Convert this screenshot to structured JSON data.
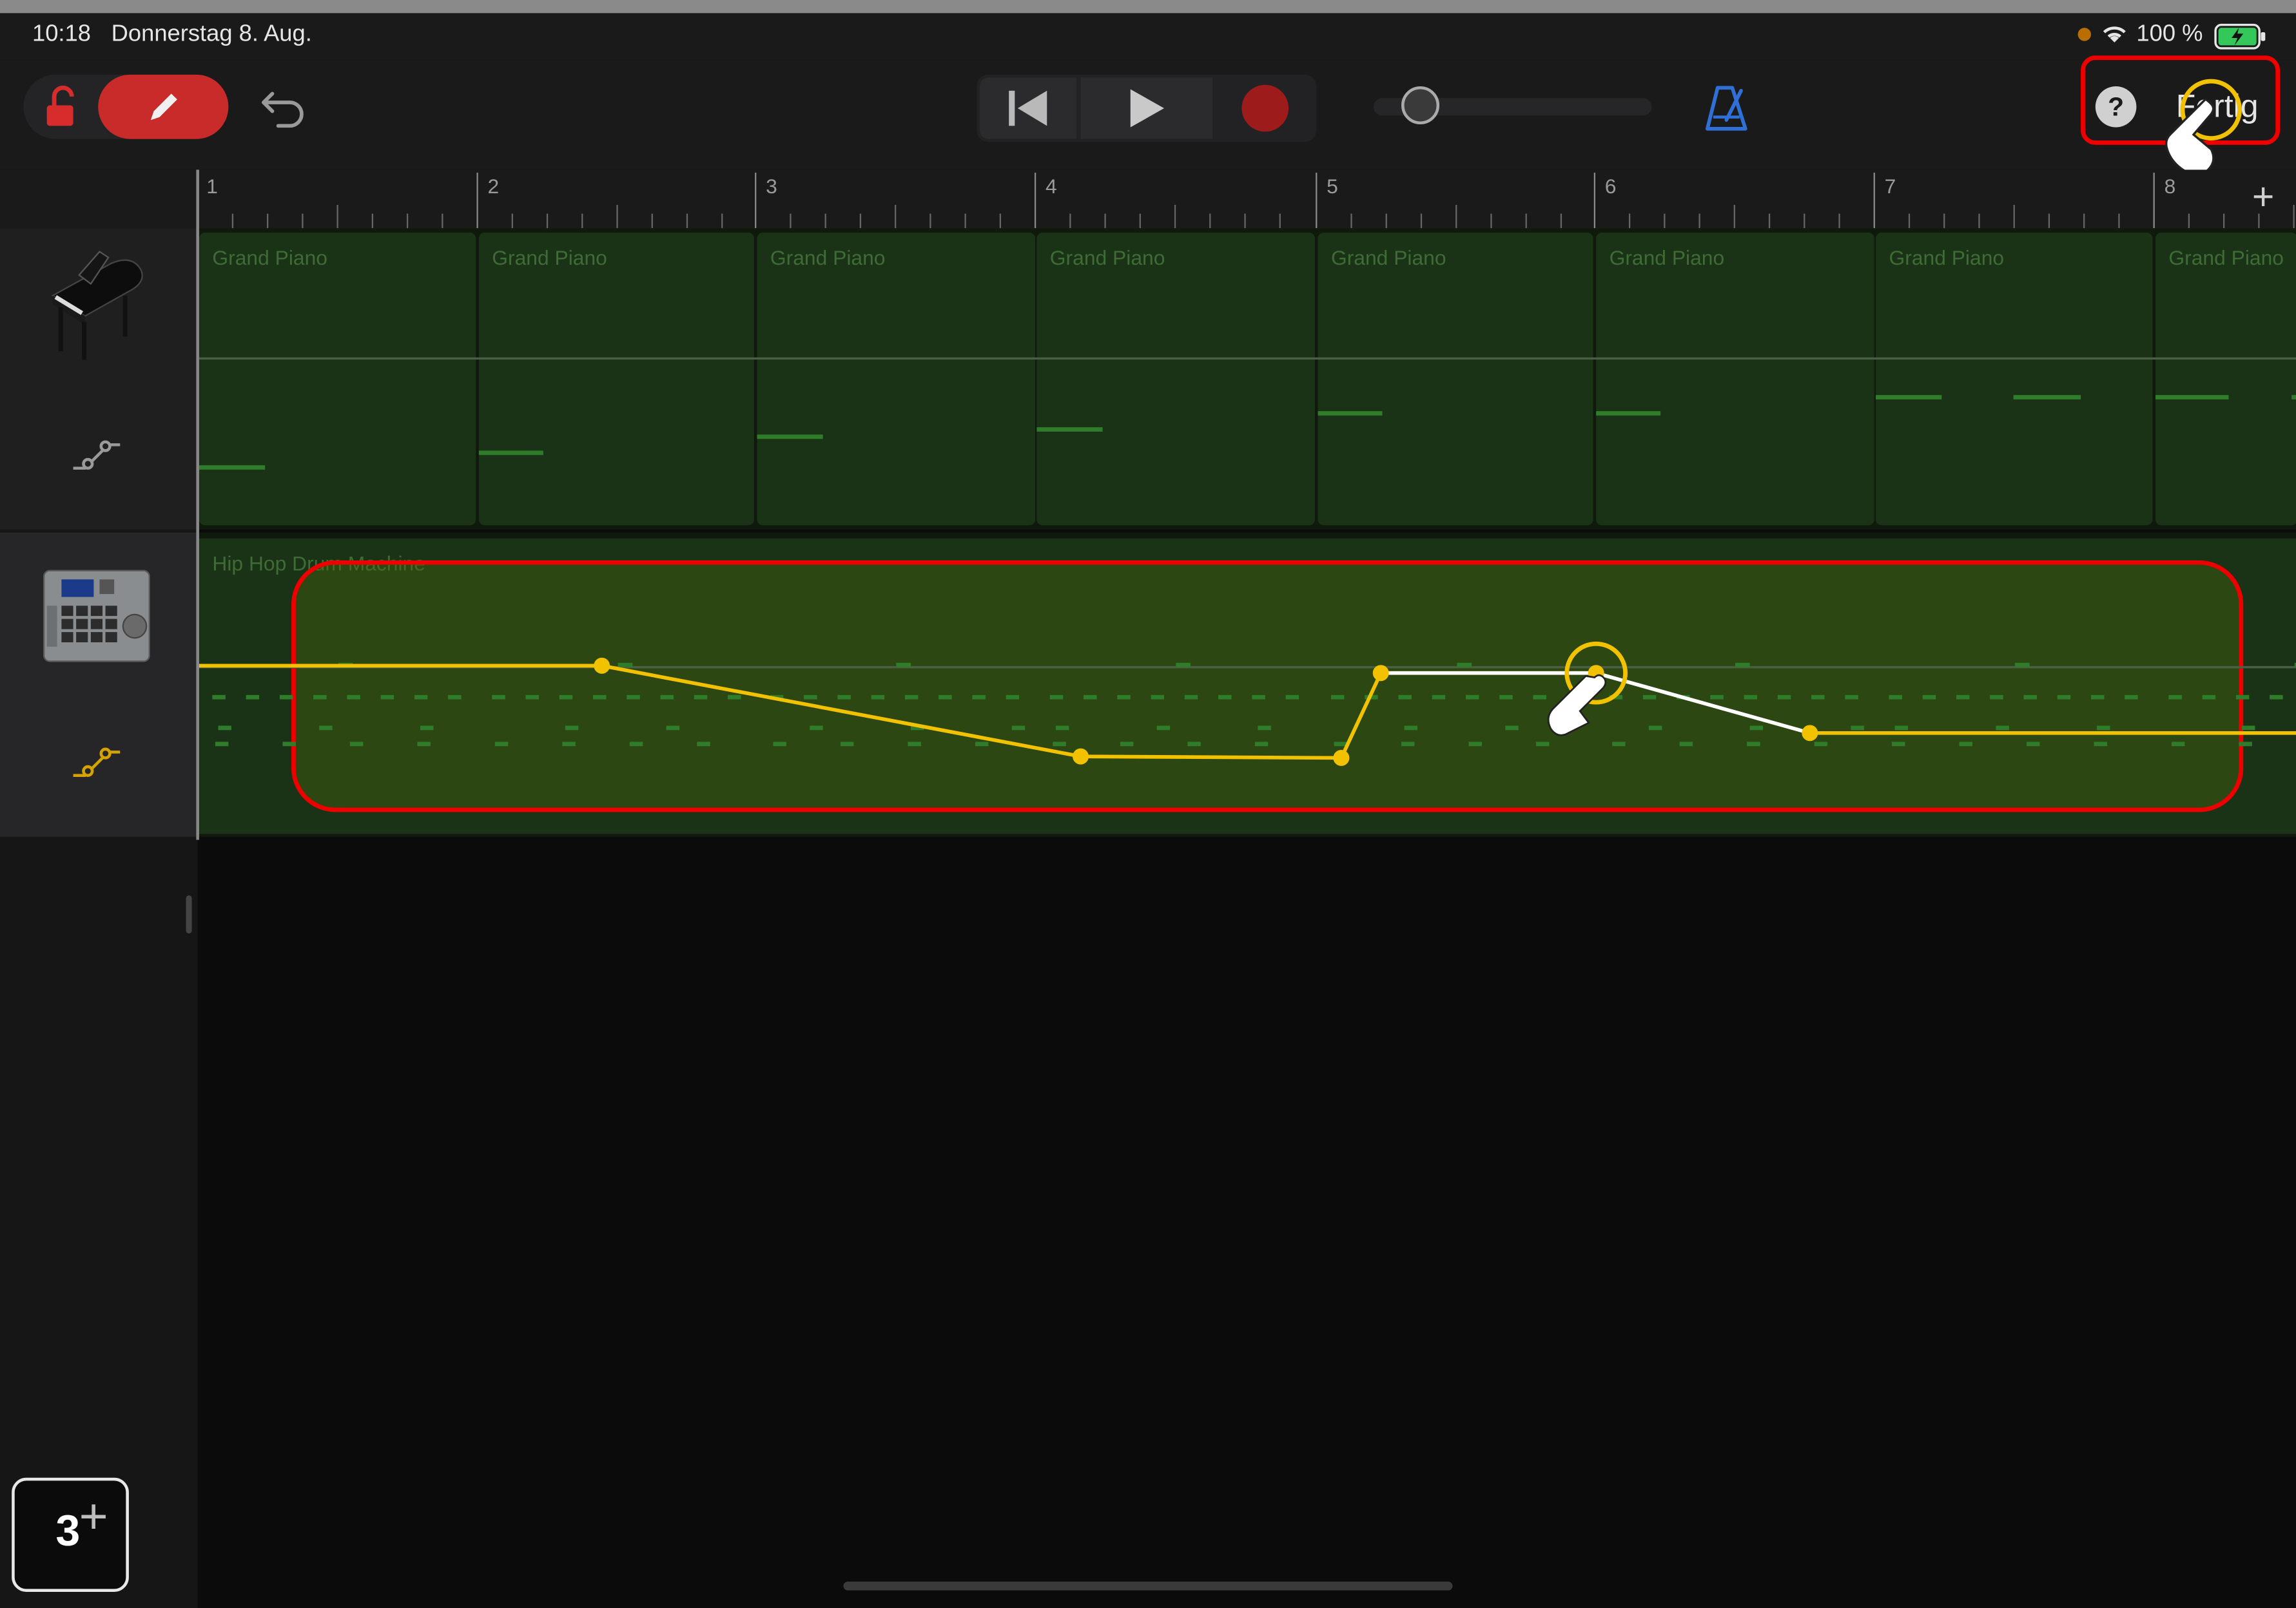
{
  "status_bar": {
    "time": "10:18",
    "date": "Donnerstag 8. Aug.",
    "battery": "100 %"
  },
  "toolbar": {
    "done_label": "Fertig",
    "help_label": "?"
  },
  "ruler": {
    "bars": [
      "1",
      "2",
      "3",
      "4",
      "5",
      "6",
      "7",
      "8"
    ],
    "add_label": "+"
  },
  "tracks": [
    {
      "name": "grand-piano",
      "regions": [
        "Grand Piano",
        "Grand Piano",
        "Grand Piano",
        "Grand Piano",
        "Grand Piano",
        "Grand Piano",
        "Grand Piano",
        "Grand Piano"
      ]
    },
    {
      "name": "drum-machine",
      "region_label": "Hip Hop Drum Machine"
    }
  ],
  "overlay": {
    "step_number": "3",
    "step_plus": "+"
  },
  "colors": {
    "accent_red": "#c92a2a",
    "automation": "#f2c200",
    "highlight": "#ee0000",
    "region_green": "#1a3316"
  }
}
